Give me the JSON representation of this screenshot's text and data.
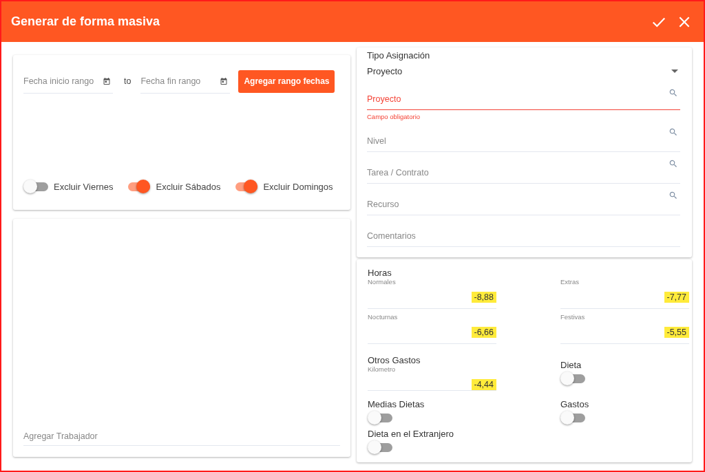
{
  "dialog": {
    "title": "Generar de forma masiva"
  },
  "date_range": {
    "start_placeholder": "Fecha inicio rango",
    "separator": "to",
    "end_placeholder": "Fecha fin rango",
    "add_button": "Agregar rango fechas"
  },
  "exclude_toggles": [
    {
      "label": "Excluir Viernes",
      "on": false
    },
    {
      "label": "Excluir Sábados",
      "on": true
    },
    {
      "label": "Excluir Domingos",
      "on": true
    }
  ],
  "worker_field": {
    "placeholder": "Agregar Trabajador"
  },
  "assignment": {
    "label": "Tipo Asignación",
    "value": "Proyecto",
    "fields": [
      {
        "placeholder": "Proyecto",
        "error": "Campo obligatorio",
        "search": true
      },
      {
        "placeholder": "Nivel",
        "search": true
      },
      {
        "placeholder": "Tarea / Contrato",
        "search": true
      },
      {
        "placeholder": "Recurso",
        "search": true
      },
      {
        "placeholder": "Comentarios",
        "search": false
      }
    ]
  },
  "hours": {
    "title": "Horas",
    "fields": [
      {
        "label": "Normales",
        "value": "-8,88",
        "highlighted": true
      },
      {
        "label": "Extras",
        "value": "-7,77",
        "highlighted": true
      },
      {
        "label": "Nocturnas",
        "value": "-6,66",
        "highlighted": true
      },
      {
        "label": "Festivas",
        "value": "-5,55",
        "highlighted": true
      }
    ]
  },
  "other_expenses": {
    "title": "Otros Gastos",
    "fields": [
      {
        "label": "Kilometro",
        "value": "-4,44",
        "highlighted": true
      }
    ]
  },
  "toggles": [
    {
      "label": "Dieta",
      "on": false
    },
    {
      "label": "Medias Dietas",
      "on": false
    },
    {
      "label": "Gastos",
      "on": false
    },
    {
      "label": "Dieta en el Extranjero",
      "on": false
    }
  ]
}
